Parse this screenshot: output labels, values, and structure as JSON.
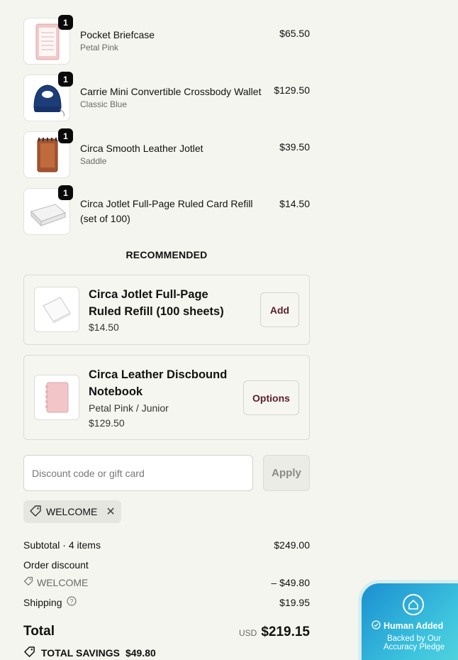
{
  "line_items": [
    {
      "name": "Pocket Briefcase",
      "variant": "Petal Pink",
      "price": "$65.50",
      "quantity": "1",
      "icon": "briefcase-thumbnail"
    },
    {
      "name": "Carrie Mini Convertible Crossbody Wallet",
      "variant": "Classic Blue",
      "price": "$129.50",
      "quantity": "1",
      "icon": "crossbody-wallet-thumbnail"
    },
    {
      "name": "Circa Smooth Leather Jotlet",
      "variant": "Saddle",
      "price": "$39.50",
      "quantity": "1",
      "icon": "jotlet-thumbnail"
    },
    {
      "name": "Circa Jotlet Full-Page Ruled Card Refill (set of 100)",
      "variant": "",
      "price": "$14.50",
      "quantity": "1",
      "icon": "card-refill-thumbnail"
    }
  ],
  "recommended": {
    "title": "RECOMMENDED",
    "items": [
      {
        "name": "Circa Jotlet Full-Page Ruled Refill (100 sheets)",
        "variant": "",
        "price": "$14.50",
        "button_label": "Add"
      },
      {
        "name": "Circa Leather Discbound Notebook",
        "variant": "Petal Pink / Junior",
        "price": "$129.50",
        "button_label": "Options"
      }
    ]
  },
  "discount": {
    "placeholder": "Discount code or gift card",
    "apply_label": "Apply",
    "applied_code": "WELCOME"
  },
  "summary": {
    "subtotal_label": "Subtotal · 4 items",
    "subtotal_value": "$249.00",
    "order_discount_label": "Order discount",
    "discount_code": "WELCOME",
    "discount_value": "– $49.80",
    "shipping_label": "Shipping",
    "shipping_value": "$19.95",
    "total_label": "Total",
    "currency": "USD",
    "total_value": "$219.15",
    "savings_label": "TOTAL SAVINGS",
    "savings_value": "$49.80"
  },
  "badge": {
    "title": "Human Added",
    "subtitle": "Backed by Our Accuracy Pledge"
  },
  "colors": {
    "background": "#f5f5f0",
    "accent_button_text": "#5b1f27",
    "badge_gradient_start": "#1b8fd0",
    "badge_gradient_end": "#5ad8dd"
  }
}
